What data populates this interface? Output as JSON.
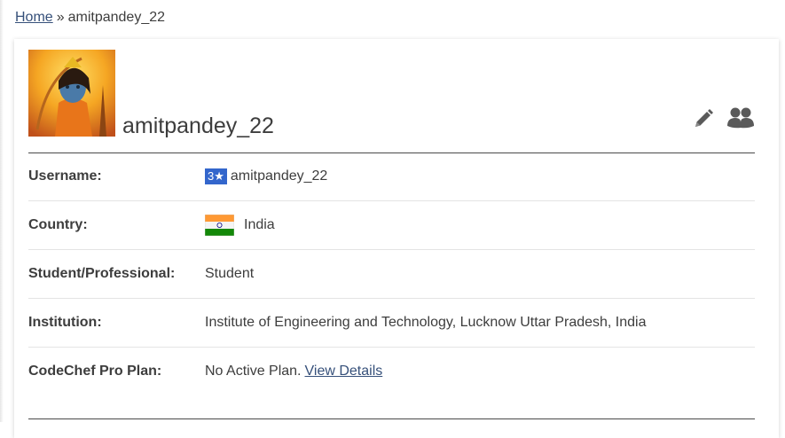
{
  "breadcrumb": {
    "home_label": "Home",
    "separator": "»",
    "current": "amitpandey_22"
  },
  "profile": {
    "name": "amitpandey_22",
    "avatar_icon": "profile-avatar-image",
    "actions": {
      "edit_icon": "pencil-icon",
      "friends_icon": "users-icon"
    }
  },
  "details": {
    "username": {
      "label": "Username:",
      "rating": "3★",
      "value": "amitpandey_22",
      "rating_color": "#3366cc"
    },
    "country": {
      "label": "Country:",
      "value": "India",
      "flag_icon": "india-flag-icon"
    },
    "occupation": {
      "label": "Student/Professional:",
      "value": "Student"
    },
    "institution": {
      "label": "Institution:",
      "value": "Institute of Engineering and Technology, Lucknow Uttar Pradesh, India"
    },
    "pro_plan": {
      "label": "CodeChef Pro Plan:",
      "value": "No Active Plan.",
      "link": "View Details"
    }
  },
  "colors": {
    "link": "#36507a",
    "text": "#3d3d3d",
    "badge": "#3366cc"
  }
}
